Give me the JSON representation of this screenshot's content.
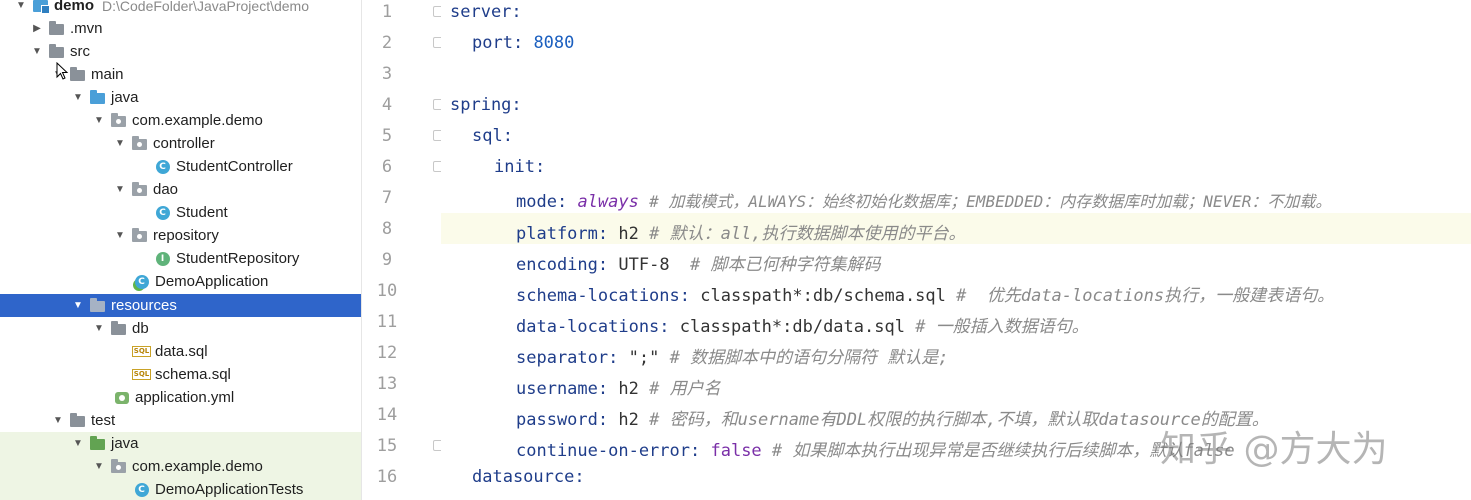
{
  "tree": {
    "project": {
      "name": "demo",
      "path": "D:\\CodeFolder\\JavaProject\\demo"
    },
    "mvn": ".mvn",
    "src": "src",
    "main": "main",
    "java": "java",
    "pkg": "com.example.demo",
    "controller": "controller",
    "student_controller": "StudentController",
    "dao": "dao",
    "student": "Student",
    "repository": "repository",
    "student_repository": "StudentRepository",
    "demo_application": "DemoApplication",
    "resources": "resources",
    "db": "db",
    "data_sql": "data.sql",
    "schema_sql": "schema.sql",
    "application_yml": "application.yml",
    "test": "test",
    "test_java": "java",
    "test_pkg": "com.example.demo",
    "demo_application_tests": "DemoApplicationTests",
    "sql_icon_text": "SQL"
  },
  "gutter": {
    "numbers": [
      "1",
      "2",
      "3",
      "4",
      "5",
      "6",
      "7",
      "8",
      "9",
      "10",
      "11",
      "12",
      "13",
      "14",
      "15",
      "16"
    ]
  },
  "code": {
    "l1_key": "server:",
    "l2_key": "port:",
    "l2_val": "8080",
    "l4_key": "spring:",
    "l5_key": "sql:",
    "l6_key": "init:",
    "l7_key": "mode:",
    "l7_val": "always",
    "l7_cm": "# 加载模式，ALWAYS：始终初始化数据库；EMBEDDED：内存数据库时加载；NEVER：不加载。",
    "l8_key": "platform:",
    "l8_val": "h2",
    "l8_cm": "# 默认：all,执行数据脚本使用的平台。",
    "l9_key": "encoding:",
    "l9_val": "UTF-8",
    "l9_cm": "# 脚本已何种字符集解码",
    "l10_key": "schema-locations:",
    "l10_val": "classpath*:db/schema.sql",
    "l10_cm": "#  优先data-locations执行，一般建表语句。",
    "l11_key": "data-locations:",
    "l11_val": "classpath*:db/data.sql",
    "l11_cm": "# 一般插入数据语句。",
    "l12_key": "separator:",
    "l12_val": "\";\"",
    "l12_cm": "# 数据脚本中的语句分隔符 默认是;",
    "l13_key": "username:",
    "l13_val": "h2",
    "l13_cm": "# 用户名",
    "l14_key": "password:",
    "l14_val": "h2",
    "l14_cm": "# 密码，和username有DDL权限的执行脚本,不填，默认取datasource的配置。",
    "l15_key": "continue-on-error:",
    "l15_val": "false",
    "l15_cm": "# 如果脚本执行出现异常是否继续执行后续脚本，默认false",
    "l16_key": "datasource:"
  },
  "watermark": "知乎 @方大为",
  "colors": {
    "selection": "#2f65ca",
    "key": "#1f3d8a",
    "number": "#1b5fbf",
    "keyword": "#7a2fa8",
    "comment": "#8a8a8a",
    "line_highlight": "#fbfbea"
  }
}
